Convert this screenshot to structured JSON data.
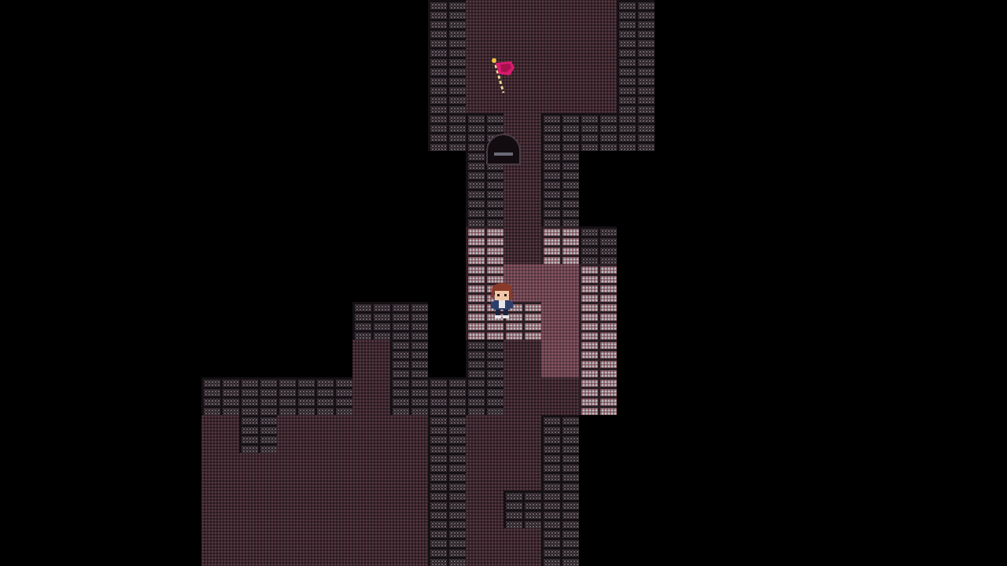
{
  "game": {
    "title": "",
    "scene": "dungeon-corridor"
  },
  "palette": {
    "background": "#000000",
    "floor": "#3a262e",
    "floor_lit": "#6b4552",
    "wall": "#2a2228",
    "wall_lit": "#8a7a80",
    "flag": "#d81b6e",
    "flag_pole": "#e8d890",
    "hero_hair": "#8a3a28",
    "hero_tunic": "#2c3e6a"
  },
  "entities": [
    {
      "name": "goal-flag",
      "icon": "flag-icon",
      "interactable": true
    },
    {
      "name": "player-hero",
      "icon": "character-sprite",
      "interactable": true
    },
    {
      "name": "north-doorway",
      "icon": "door-arch-icon",
      "interactable": true
    }
  ]
}
